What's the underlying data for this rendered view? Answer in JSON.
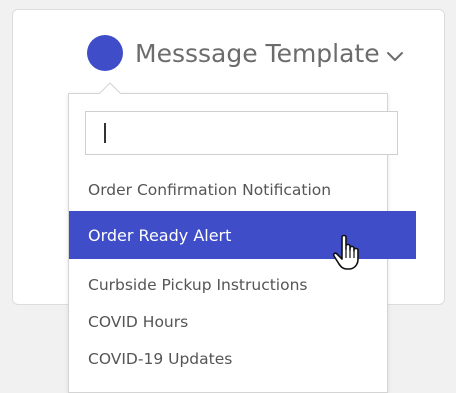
{
  "header": {
    "title": "Messsage Template",
    "dot_color": "#3f4dc8",
    "chevron_icon": "chevron-down-icon"
  },
  "dropdown": {
    "search": {
      "value": "",
      "placeholder": ""
    },
    "items": [
      {
        "label": "Order Confirmation Notification",
        "selected": false
      },
      {
        "label": "Order Ready Alert",
        "selected": true
      },
      {
        "label": "Curbside Pickup Instructions",
        "selected": false
      },
      {
        "label": "COVID Hours",
        "selected": false
      },
      {
        "label": "COVID-19 Updates",
        "selected": false
      }
    ]
  },
  "colors": {
    "accent": "#3f4dc8",
    "text_muted": "#6c6c6c",
    "item_text": "#555555"
  },
  "cursor_icon": "hand-pointer-icon"
}
